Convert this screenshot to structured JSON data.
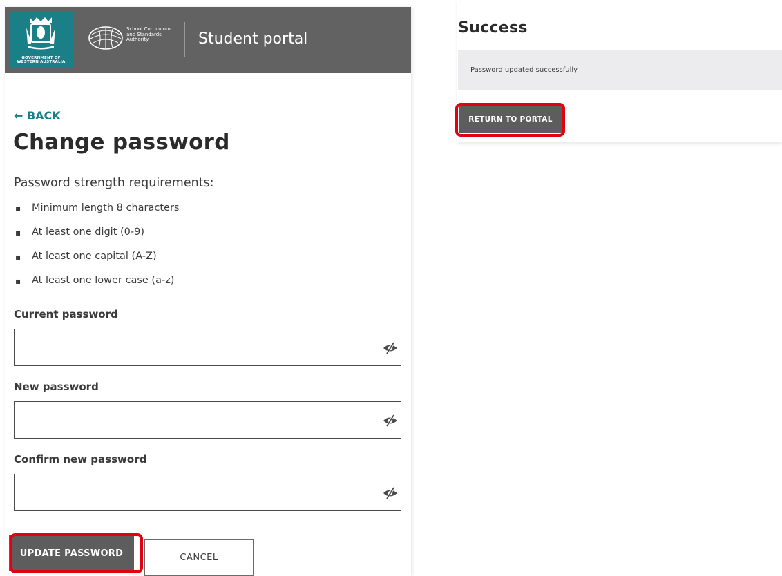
{
  "header": {
    "gov_logo_text": [
      "GOVERNMENT OF",
      "WESTERN AUSTRALIA"
    ],
    "authority_name": [
      "School Curriculum",
      "and Standards",
      "Authority"
    ],
    "portal_title": "Student portal"
  },
  "form": {
    "back_label": "← BACK",
    "title": "Change password",
    "requirements_heading": "Password strength requirements:",
    "requirements": [
      "Minimum length 8 characters",
      "At least one digit (0-9)",
      "At least one capital (A-Z)",
      "At least one lower case (a-z)"
    ],
    "fields": [
      {
        "label": "Current password",
        "value": "",
        "placeholder": ""
      },
      {
        "label": "New password",
        "value": "",
        "placeholder": ""
      },
      {
        "label": "Confirm new password",
        "value": "",
        "placeholder": ""
      }
    ],
    "update_label": "UPDATE PASSWORD",
    "cancel_label": "CANCEL"
  },
  "success": {
    "title": "Success",
    "message": "Password updated successfully",
    "return_label": "RETURN TO PORTAL"
  },
  "icons": {
    "password_toggle": "eye-slash-icon",
    "gov_crest": "crest-icon",
    "authority_logo": "scsa-logo-icon"
  },
  "colors": {
    "header_bg": "#626262",
    "gov_logo_bg": "#1a7f86",
    "link": "#1a7f86",
    "primary_button": "#5d5d5d",
    "highlight": "#e3000f",
    "message_bg": "#ececee"
  }
}
